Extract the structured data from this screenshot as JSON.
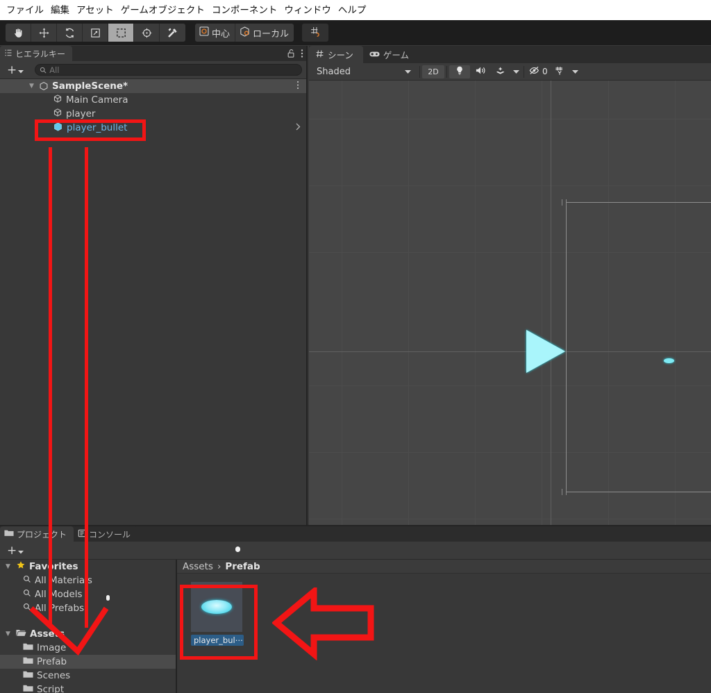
{
  "menubar": {
    "items": [
      "ファイル",
      "編集",
      "アセット",
      "ゲームオブジェクト",
      "コンポーネント",
      "ウィンドウ",
      "ヘルプ"
    ]
  },
  "toolbar": {
    "tools": [
      {
        "name": "hand-tool",
        "icon": "hand-icon",
        "active": false
      },
      {
        "name": "move-tool",
        "icon": "move-arrows-icon",
        "active": false
      },
      {
        "name": "rotate-tool",
        "icon": "rotate-icon",
        "active": false
      },
      {
        "name": "scale-tool",
        "icon": "scale-icon",
        "active": false
      },
      {
        "name": "rect-tool",
        "icon": "rect-transform-icon",
        "active": true
      },
      {
        "name": "transform-tool",
        "icon": "transform-move-icon",
        "active": false
      },
      {
        "name": "custom-tool",
        "icon": "tools-icon",
        "active": false
      }
    ],
    "pivot_label": "中心",
    "handle_label": "ローカル",
    "snap_label": "grid-snap-icon"
  },
  "hierarchy": {
    "tab_label": "ヒエラルキー",
    "tab_icon": "hierarchy-icon",
    "lock_icon": "lock-open-icon",
    "menu_icon": "kebab-icon",
    "add_label": "+",
    "search_placeholder": "All",
    "rows": [
      {
        "label": "SampleScene*",
        "icon": "scene-icon",
        "depth": 0,
        "type": "scene"
      },
      {
        "label": "Main Camera",
        "icon": "gameobject-icon",
        "depth": 1,
        "type": "object"
      },
      {
        "label": "player",
        "icon": "gameobject-icon",
        "depth": 1,
        "type": "object"
      },
      {
        "label": "player_bullet",
        "icon": "prefab-icon",
        "depth": 1,
        "type": "prefab-selected"
      }
    ]
  },
  "scene": {
    "tabs": [
      {
        "label": "シーン",
        "icon": "scene-grid-icon",
        "active": true
      },
      {
        "label": "ゲーム",
        "icon": "gamepad-icon",
        "active": false
      }
    ],
    "draw_mode": "Shaded",
    "button_2d": "2D",
    "lighting_icon": "lightbulb-icon",
    "audio_icon": "speaker-icon",
    "fx_icon": "effects-icon",
    "hidden_count": "0",
    "hidden_icon": "eye-off-icon",
    "gizmos_icon": "gizmos-icon"
  },
  "project": {
    "tabs": [
      {
        "label": "プロジェクト",
        "icon": "folder-icon",
        "active": true
      },
      {
        "label": "コンソール",
        "icon": "console-icon",
        "active": false
      }
    ],
    "add_label": "+",
    "tree": [
      {
        "label": "Favorites",
        "icon": "star-icon",
        "type": "header",
        "expanded": true
      },
      {
        "label": "All Materials",
        "icon": "search-icon",
        "type": "favorite"
      },
      {
        "label": "All Models",
        "icon": "search-icon",
        "type": "favorite"
      },
      {
        "label": "All Prefabs",
        "icon": "search-icon",
        "type": "favorite"
      },
      {
        "label": "Assets",
        "icon": "folder-open-icon",
        "type": "header",
        "expanded": true
      },
      {
        "label": "Image",
        "icon": "folder-icon",
        "type": "folder"
      },
      {
        "label": "Prefab",
        "icon": "folder-icon",
        "type": "folder",
        "selected": true
      },
      {
        "label": "Scenes",
        "icon": "folder-icon",
        "type": "folder"
      },
      {
        "label": "Script",
        "icon": "folder-icon",
        "type": "folder"
      }
    ],
    "breadcrumb": {
      "root": "Assets",
      "sep": "›",
      "current": "Prefab"
    },
    "assets": [
      {
        "label": "player_bul⋯",
        "thumb": "bullet-sprite",
        "selected": true
      }
    ]
  },
  "annotations": {
    "accent": "#f21515",
    "hierarchy_box": "highlights player_bullet row",
    "asset_box": "highlights player_bullet prefab asset",
    "arrow_left": "points to prefab asset",
    "arrows_down": "two vertical lines from hierarchy to Assets folder"
  }
}
